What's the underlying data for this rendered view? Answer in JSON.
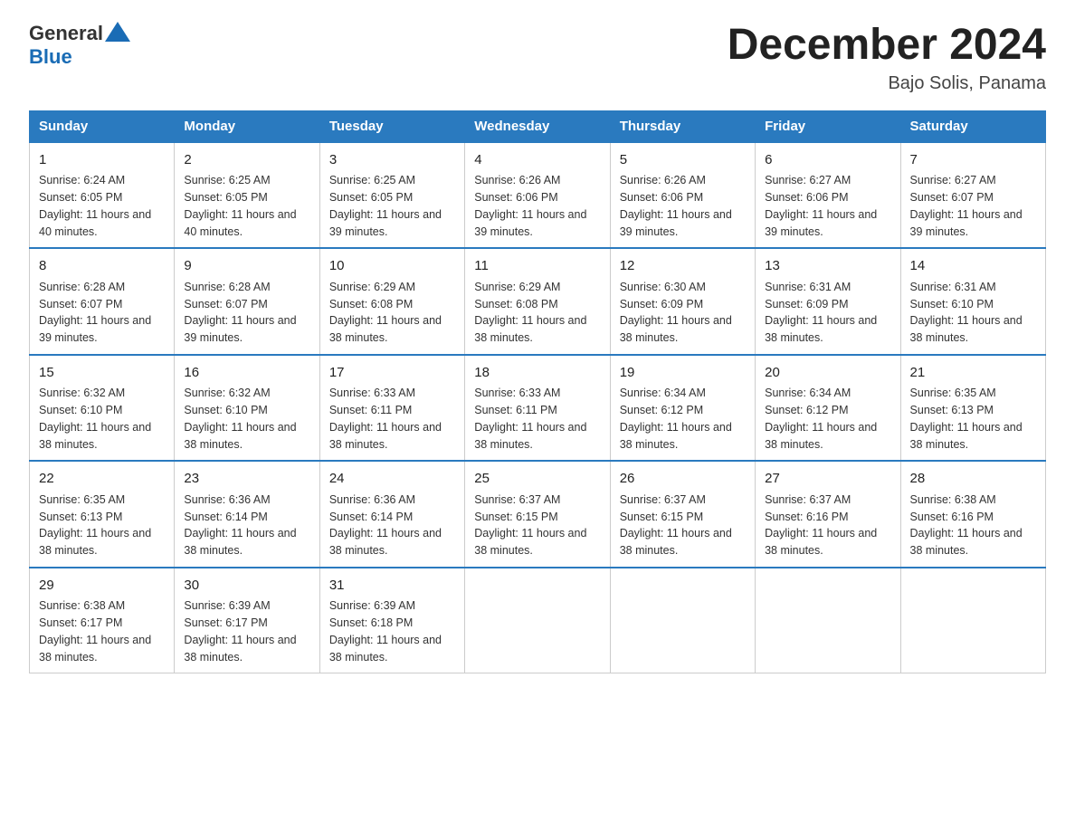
{
  "logo": {
    "general": "General",
    "blue": "Blue"
  },
  "title": "December 2024",
  "subtitle": "Bajo Solis, Panama",
  "days_of_week": [
    "Sunday",
    "Monday",
    "Tuesday",
    "Wednesday",
    "Thursday",
    "Friday",
    "Saturday"
  ],
  "weeks": [
    [
      {
        "num": "1",
        "sunrise": "6:24 AM",
        "sunset": "6:05 PM",
        "daylight": "11 hours and 40 minutes."
      },
      {
        "num": "2",
        "sunrise": "6:25 AM",
        "sunset": "6:05 PM",
        "daylight": "11 hours and 40 minutes."
      },
      {
        "num": "3",
        "sunrise": "6:25 AM",
        "sunset": "6:05 PM",
        "daylight": "11 hours and 39 minutes."
      },
      {
        "num": "4",
        "sunrise": "6:26 AM",
        "sunset": "6:06 PM",
        "daylight": "11 hours and 39 minutes."
      },
      {
        "num": "5",
        "sunrise": "6:26 AM",
        "sunset": "6:06 PM",
        "daylight": "11 hours and 39 minutes."
      },
      {
        "num": "6",
        "sunrise": "6:27 AM",
        "sunset": "6:06 PM",
        "daylight": "11 hours and 39 minutes."
      },
      {
        "num": "7",
        "sunrise": "6:27 AM",
        "sunset": "6:07 PM",
        "daylight": "11 hours and 39 minutes."
      }
    ],
    [
      {
        "num": "8",
        "sunrise": "6:28 AM",
        "sunset": "6:07 PM",
        "daylight": "11 hours and 39 minutes."
      },
      {
        "num": "9",
        "sunrise": "6:28 AM",
        "sunset": "6:07 PM",
        "daylight": "11 hours and 39 minutes."
      },
      {
        "num": "10",
        "sunrise": "6:29 AM",
        "sunset": "6:08 PM",
        "daylight": "11 hours and 38 minutes."
      },
      {
        "num": "11",
        "sunrise": "6:29 AM",
        "sunset": "6:08 PM",
        "daylight": "11 hours and 38 minutes."
      },
      {
        "num": "12",
        "sunrise": "6:30 AM",
        "sunset": "6:09 PM",
        "daylight": "11 hours and 38 minutes."
      },
      {
        "num": "13",
        "sunrise": "6:31 AM",
        "sunset": "6:09 PM",
        "daylight": "11 hours and 38 minutes."
      },
      {
        "num": "14",
        "sunrise": "6:31 AM",
        "sunset": "6:10 PM",
        "daylight": "11 hours and 38 minutes."
      }
    ],
    [
      {
        "num": "15",
        "sunrise": "6:32 AM",
        "sunset": "6:10 PM",
        "daylight": "11 hours and 38 minutes."
      },
      {
        "num": "16",
        "sunrise": "6:32 AM",
        "sunset": "6:10 PM",
        "daylight": "11 hours and 38 minutes."
      },
      {
        "num": "17",
        "sunrise": "6:33 AM",
        "sunset": "6:11 PM",
        "daylight": "11 hours and 38 minutes."
      },
      {
        "num": "18",
        "sunrise": "6:33 AM",
        "sunset": "6:11 PM",
        "daylight": "11 hours and 38 minutes."
      },
      {
        "num": "19",
        "sunrise": "6:34 AM",
        "sunset": "6:12 PM",
        "daylight": "11 hours and 38 minutes."
      },
      {
        "num": "20",
        "sunrise": "6:34 AM",
        "sunset": "6:12 PM",
        "daylight": "11 hours and 38 minutes."
      },
      {
        "num": "21",
        "sunrise": "6:35 AM",
        "sunset": "6:13 PM",
        "daylight": "11 hours and 38 minutes."
      }
    ],
    [
      {
        "num": "22",
        "sunrise": "6:35 AM",
        "sunset": "6:13 PM",
        "daylight": "11 hours and 38 minutes."
      },
      {
        "num": "23",
        "sunrise": "6:36 AM",
        "sunset": "6:14 PM",
        "daylight": "11 hours and 38 minutes."
      },
      {
        "num": "24",
        "sunrise": "6:36 AM",
        "sunset": "6:14 PM",
        "daylight": "11 hours and 38 minutes."
      },
      {
        "num": "25",
        "sunrise": "6:37 AM",
        "sunset": "6:15 PM",
        "daylight": "11 hours and 38 minutes."
      },
      {
        "num": "26",
        "sunrise": "6:37 AM",
        "sunset": "6:15 PM",
        "daylight": "11 hours and 38 minutes."
      },
      {
        "num": "27",
        "sunrise": "6:37 AM",
        "sunset": "6:16 PM",
        "daylight": "11 hours and 38 minutes."
      },
      {
        "num": "28",
        "sunrise": "6:38 AM",
        "sunset": "6:16 PM",
        "daylight": "11 hours and 38 minutes."
      }
    ],
    [
      {
        "num": "29",
        "sunrise": "6:38 AM",
        "sunset": "6:17 PM",
        "daylight": "11 hours and 38 minutes."
      },
      {
        "num": "30",
        "sunrise": "6:39 AM",
        "sunset": "6:17 PM",
        "daylight": "11 hours and 38 minutes."
      },
      {
        "num": "31",
        "sunrise": "6:39 AM",
        "sunset": "6:18 PM",
        "daylight": "11 hours and 38 minutes."
      },
      {
        "num": "",
        "sunrise": "",
        "sunset": "",
        "daylight": ""
      },
      {
        "num": "",
        "sunrise": "",
        "sunset": "",
        "daylight": ""
      },
      {
        "num": "",
        "sunrise": "",
        "sunset": "",
        "daylight": ""
      },
      {
        "num": "",
        "sunrise": "",
        "sunset": "",
        "daylight": ""
      }
    ]
  ],
  "sunrise_label": "Sunrise:",
  "sunset_label": "Sunset:",
  "daylight_label": "Daylight:"
}
